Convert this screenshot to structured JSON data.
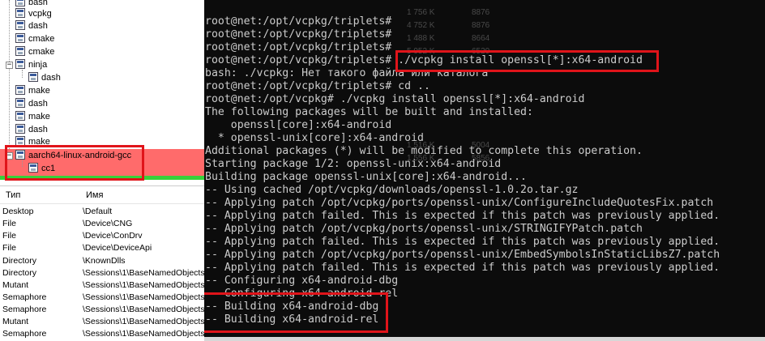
{
  "tree": {
    "items": [
      "bash",
      "vcpkg",
      "dash",
      "cmake",
      "cmake",
      "ninja",
      "dash",
      "make",
      "dash",
      "make",
      "dash",
      "make",
      "aarch64-linux-android-gcc",
      "cc1"
    ]
  },
  "handles": {
    "columns": [
      "Тип",
      "Имя"
    ],
    "rows": [
      {
        "type": "Desktop",
        "name": "\\Default"
      },
      {
        "type": "File",
        "name": "\\Device\\CNG"
      },
      {
        "type": "File",
        "name": "\\Device\\ConDrv"
      },
      {
        "type": "File",
        "name": "\\Device\\DeviceApi"
      },
      {
        "type": "Directory",
        "name": "\\KnownDlls"
      },
      {
        "type": "Directory",
        "name": "\\Sessions\\1\\BaseNamedObjects"
      },
      {
        "type": "Mutant",
        "name": "\\Sessions\\1\\BaseNamedObjects"
      },
      {
        "type": "Semaphore",
        "name": "\\Sessions\\1\\BaseNamedObjects"
      },
      {
        "type": "Semaphore",
        "name": "\\Sessions\\1\\BaseNamedObjects"
      },
      {
        "type": "Mutant",
        "name": "\\Sessions\\1\\BaseNamedObjects"
      },
      {
        "type": "Semaphore",
        "name": "\\Sessions\\1\\BaseNamedObjects"
      }
    ]
  },
  "console": {
    "ghost_values": [
      "1 756 K",
      "8876",
      "4 752 K",
      "8876",
      "1 488 K",
      "8664",
      "5 952 K",
      "6520",
      "1 516 K",
      "5004",
      "1 556 K",
      "5856"
    ],
    "lines": [
      "root@net:/opt/vcpkg/triplets#",
      "root@net:/opt/vcpkg/triplets#",
      "root@net:/opt/vcpkg/triplets#",
      "root@net:/opt/vcpkg/triplets# ./vcpkg install openssl[*]:x64-android",
      "bash: ./vcpkg: Нет такого файла или каталога",
      "root@net:/opt/vcpkg/triplets# cd ..",
      "root@net:/opt/vcpkg# ./vcpkg install openssl[*]:x64-android",
      "The following packages will be built and installed:",
      "    openssl[core]:x64-android",
      "  * openssl-unix[core]:x64-android",
      "Additional packages (*) will be modified to complete this operation.",
      "Starting package 1/2: openssl-unix:x64-android",
      "Building package openssl-unix[core]:x64-android...",
      "-- Using cached /opt/vcpkg/downloads/openssl-1.0.2o.tar.gz",
      "-- Applying patch /opt/vcpkg/ports/openssl-unix/ConfigureIncludeQuotesFix.patch",
      "-- Applying patch failed. This is expected if this patch was previously applied.",
      "-- Applying patch /opt/vcpkg/ports/openssl-unix/STRINGIFYPatch.patch",
      "-- Applying patch failed. This is expected if this patch was previously applied.",
      "-- Applying patch /opt/vcpkg/ports/openssl-unix/EmbedSymbolsInStaticLibsZ7.patch",
      "-- Applying patch failed. This is expected if this patch was previously applied.",
      "-- Configuring x64-android-dbg",
      "-- Configuring x64-android-rel",
      "-- Building x64-android-dbg",
      "-- Building x64-android-rel"
    ]
  }
}
